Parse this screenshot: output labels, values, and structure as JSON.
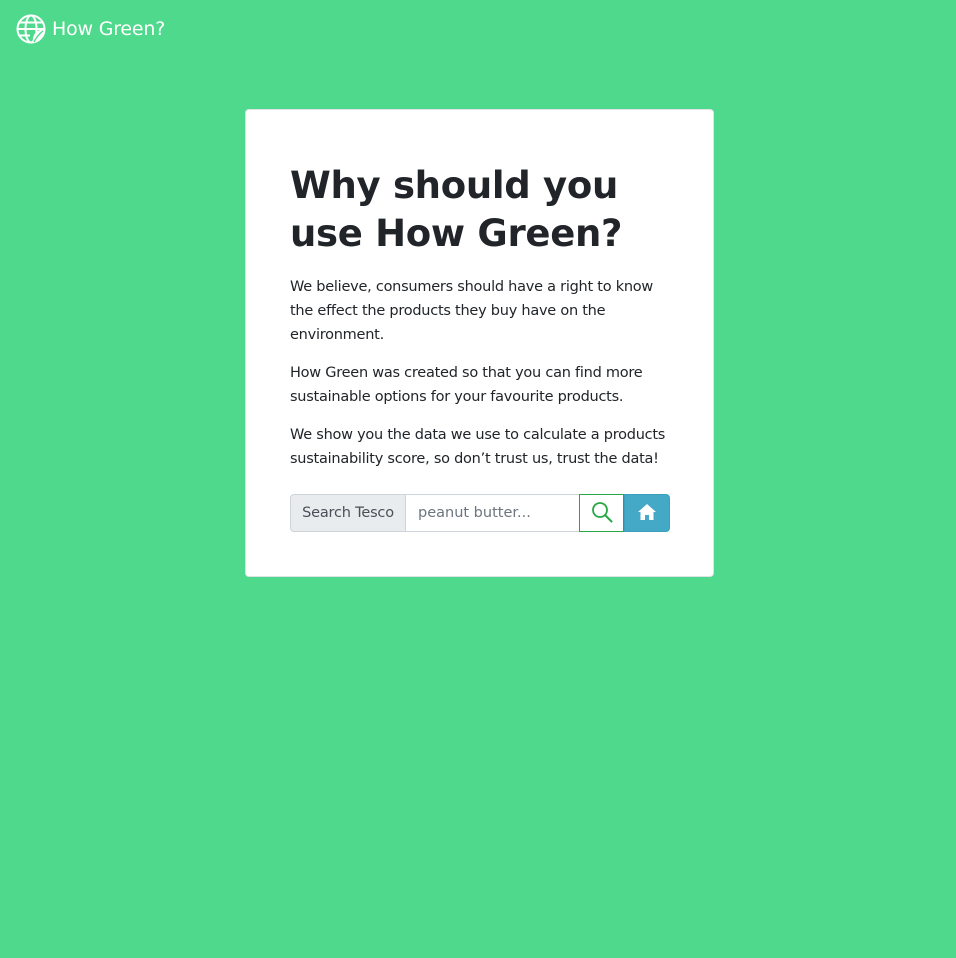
{
  "navbar": {
    "brand_text": "How Green?",
    "brand_icon": "globe-leaf-icon"
  },
  "card": {
    "title": "Why should you use How Green?",
    "paragraphs": [
      "We believe, consumers should have a right to know the effect the products they buy have on the environment.",
      "How Green was created so that you can find more sustainable options for your favourite products.",
      "We show you the data we use to calculate a products sustainability score, so don’t trust us, trust the data!"
    ]
  },
  "search": {
    "prepend_label": "Search Tesco",
    "placeholder": "peanut butter...",
    "value": "",
    "search_icon": "search-icon",
    "home_icon": "home-icon"
  },
  "colors": {
    "background": "#4fd98c",
    "card": "#ffffff",
    "search_button_border": "#28a745",
    "home_button": "#44a9c6"
  }
}
